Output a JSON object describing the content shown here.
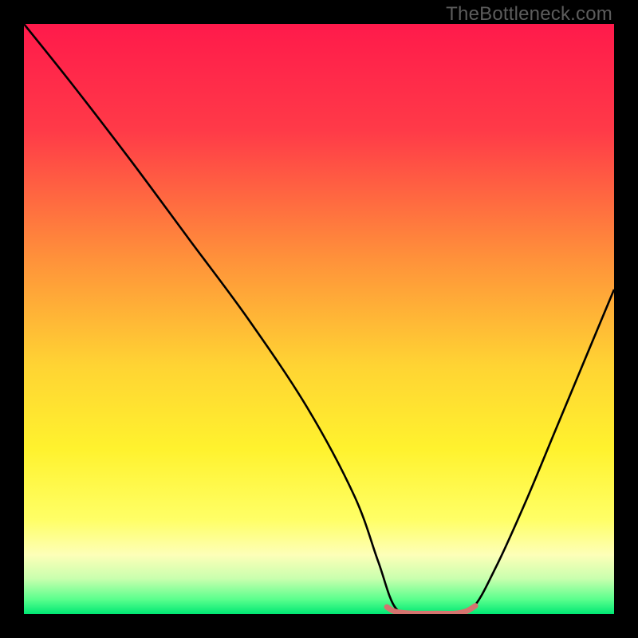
{
  "watermark": "TheBottleneck.com",
  "chart_data": {
    "type": "line",
    "title": "",
    "xlabel": "",
    "ylabel": "",
    "xlim": [
      0,
      100
    ],
    "ylim": [
      0,
      100
    ],
    "gradient_stops": [
      {
        "offset": 0.0,
        "color": "#ff1a4b"
      },
      {
        "offset": 0.18,
        "color": "#ff3a48"
      },
      {
        "offset": 0.4,
        "color": "#ff923a"
      },
      {
        "offset": 0.58,
        "color": "#ffd433"
      },
      {
        "offset": 0.72,
        "color": "#fff22e"
      },
      {
        "offset": 0.84,
        "color": "#ffff66"
      },
      {
        "offset": 0.9,
        "color": "#fdffb8"
      },
      {
        "offset": 0.94,
        "color": "#c9ffae"
      },
      {
        "offset": 0.975,
        "color": "#5bff8d"
      },
      {
        "offset": 1.0,
        "color": "#00e874"
      }
    ],
    "series": [
      {
        "name": "V-curve",
        "color": "#000000",
        "width": 2.6,
        "x": [
          0,
          8,
          18,
          28,
          38,
          48,
          56,
          60,
          63,
          67,
          72,
          76,
          80,
          85,
          90,
          95,
          100
        ],
        "y": [
          100,
          90,
          77,
          63.5,
          50,
          35,
          20,
          9,
          1,
          0,
          0,
          1,
          8,
          19,
          31,
          43,
          55
        ]
      },
      {
        "name": "optimum-marker",
        "color": "#d5746f",
        "width": 7,
        "cap": "round",
        "x": [
          61.5,
          63,
          66,
          70,
          73,
          75,
          76.5
        ],
        "y": [
          1.2,
          0.4,
          0.1,
          0.1,
          0.1,
          0.5,
          1.4
        ]
      }
    ]
  }
}
